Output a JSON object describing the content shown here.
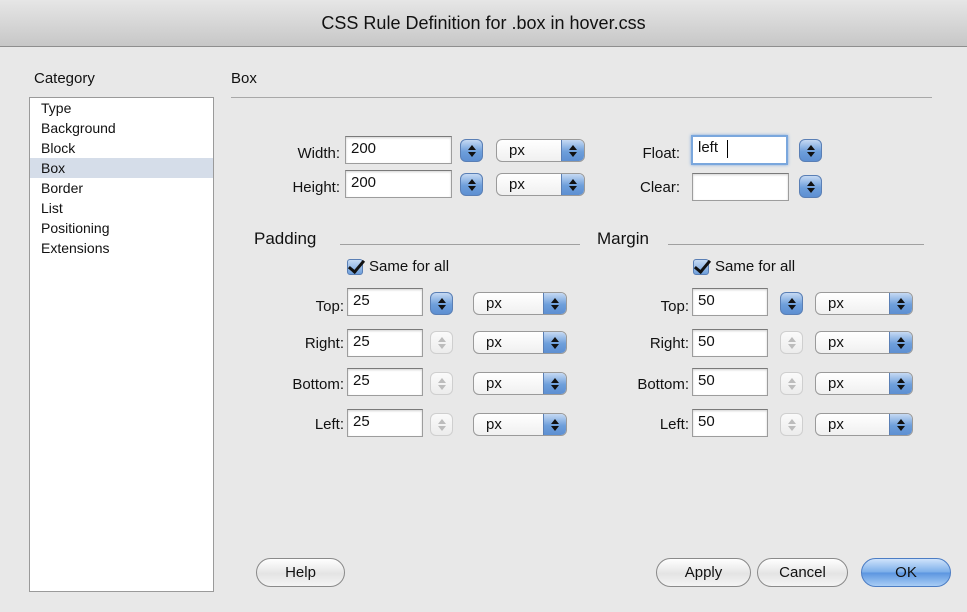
{
  "window": {
    "title": "CSS Rule Definition for .box in hover.css"
  },
  "category": {
    "label": "Category",
    "items": [
      "Type",
      "Background",
      "Block",
      "Box",
      "Border",
      "List",
      "Positioning",
      "Extensions"
    ],
    "selected": "Box"
  },
  "section": {
    "title": "Box"
  },
  "box": {
    "width": {
      "label": "Width:",
      "value": "200",
      "unit": "px"
    },
    "height": {
      "label": "Height:",
      "value": "200",
      "unit": "px"
    },
    "float": {
      "label": "Float:",
      "value": "left"
    },
    "clear": {
      "label": "Clear:",
      "value": ""
    }
  },
  "padding": {
    "title": "Padding",
    "same_for_all": "Same for all",
    "top": {
      "label": "Top:",
      "value": "25",
      "unit": "px"
    },
    "right": {
      "label": "Right:",
      "value": "25",
      "unit": "px"
    },
    "bottom": {
      "label": "Bottom:",
      "value": "25",
      "unit": "px"
    },
    "left": {
      "label": "Left:",
      "value": "25",
      "unit": "px"
    }
  },
  "margin": {
    "title": "Margin",
    "same_for_all": "Same for all",
    "top": {
      "label": "Top:",
      "value": "50",
      "unit": "px"
    },
    "right": {
      "label": "Right:",
      "value": "50",
      "unit": "px"
    },
    "bottom": {
      "label": "Bottom:",
      "value": "50",
      "unit": "px"
    },
    "left": {
      "label": "Left:",
      "value": "50",
      "unit": "px"
    }
  },
  "buttons": {
    "help": "Help",
    "apply": "Apply",
    "cancel": "Cancel",
    "ok": "OK"
  },
  "colors": {
    "accent": "#6e9fdb",
    "selection": "#d5dde9"
  }
}
